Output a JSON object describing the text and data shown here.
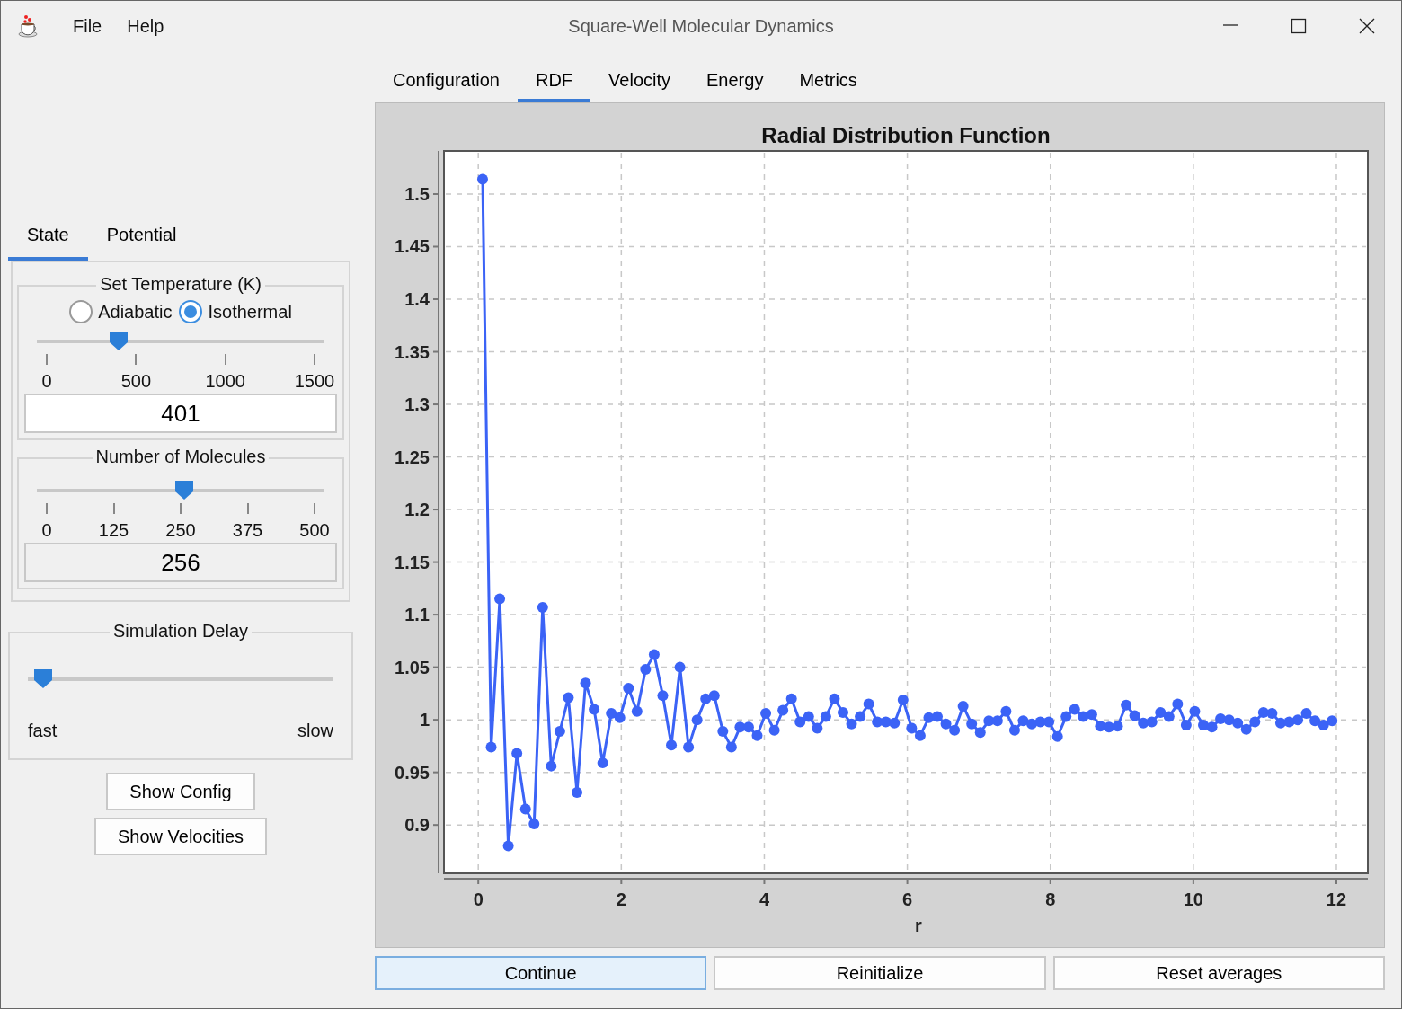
{
  "window": {
    "title": "Square-Well Molecular Dynamics"
  },
  "menu": [
    {
      "label": "File"
    },
    {
      "label": "Help"
    }
  ],
  "main_tabs": [
    {
      "label": "Configuration",
      "selected": false
    },
    {
      "label": "RDF",
      "selected": true
    },
    {
      "label": "Velocity",
      "selected": false
    },
    {
      "label": "Energy",
      "selected": false
    },
    {
      "label": "Metrics",
      "selected": false
    }
  ],
  "side_tabs": [
    {
      "label": "State",
      "selected": true
    },
    {
      "label": "Potential",
      "selected": false
    }
  ],
  "temperature": {
    "title": "Set Temperature (K)",
    "modes": [
      {
        "label": "Adiabatic",
        "selected": false
      },
      {
        "label": "Isothermal",
        "selected": true
      }
    ],
    "slider": {
      "level": 0.267,
      "ticks": [
        "0",
        "500",
        "1000",
        "1500"
      ]
    },
    "value": "401"
  },
  "molecules": {
    "title": "Number of Molecules",
    "slider": {
      "level": 0.512,
      "ticks": [
        "0",
        "125",
        "250",
        "375",
        "500"
      ]
    },
    "value": "256"
  },
  "delay": {
    "title": "Simulation Delay",
    "slider": {
      "level": 0.02
    },
    "min_label": "fast",
    "max_label": "slow"
  },
  "side_buttons": [
    {
      "label": "Show Config"
    },
    {
      "label": "Show Velocities"
    }
  ],
  "chart": {
    "chart_data": {
      "type": "line",
      "title": "Radial Distribution Function",
      "xlabel": "r",
      "x": [
        0.06,
        0.18,
        0.3,
        0.42,
        0.54,
        0.66,
        0.78,
        0.9,
        1.02,
        1.14,
        1.26,
        1.38,
        1.5,
        1.62,
        1.74,
        1.86,
        1.98,
        2.1,
        2.22,
        2.34,
        2.46,
        2.58,
        2.7,
        2.82,
        2.94,
        3.06,
        3.18,
        3.3,
        3.42,
        3.54,
        3.66,
        3.78,
        3.9,
        4.02,
        4.14,
        4.26,
        4.38,
        4.5,
        4.62,
        4.74,
        4.86,
        4.98,
        5.1,
        5.22,
        5.34,
        5.46,
        5.58,
        5.7,
        5.82,
        5.94,
        6.06,
        6.18,
        6.3,
        6.42,
        6.54,
        6.66,
        6.78,
        6.9,
        7.02,
        7.14,
        7.26,
        7.38,
        7.5,
        7.62,
        7.74,
        7.86,
        7.98,
        8.1,
        8.22,
        8.34,
        8.46,
        8.58,
        8.7,
        8.82,
        8.94,
        9.06,
        9.18,
        9.3,
        9.42,
        9.54,
        9.66,
        9.78,
        9.9,
        10.02,
        10.14,
        10.26,
        10.38,
        10.5,
        10.62,
        10.74,
        10.86,
        10.98,
        11.1,
        11.22,
        11.34,
        11.46,
        11.58,
        11.7,
        11.82,
        11.94
      ],
      "grid": true,
      "series": [
        {
          "color": "#3b63f6",
          "marker": "circle",
          "values": [
            1.514,
            0.974,
            1.115,
            0.88,
            0.968,
            0.915,
            0.901,
            1.107,
            0.956,
            0.989,
            1.021,
            0.931,
            1.035,
            1.01,
            0.959,
            1.006,
            1.002,
            1.03,
            1.008,
            1.048,
            1.062,
            1.023,
            0.976,
            1.05,
            0.974,
            1.0,
            1.02,
            1.023,
            0.989,
            0.974,
            0.993,
            0.993,
            0.985,
            1.006,
            0.99,
            1.009,
            1.02,
            0.998,
            1.003,
            0.992,
            1.003,
            1.02,
            1.007,
            0.996,
            1.003,
            1.015,
            0.998,
            0.998,
            0.997,
            1.019,
            0.992,
            0.985,
            1.002,
            1.003,
            0.996,
            0.99,
            1.013,
            0.996,
            0.988,
            0.999,
            0.999,
            1.008,
            0.99,
            0.999,
            0.996,
            0.998,
            0.998,
            0.984,
            1.003,
            1.01,
            1.003,
            1.005,
            0.994,
            0.993,
            0.994,
            1.014,
            1.004,
            0.997,
            0.998,
            1.007,
            1.003,
            1.015,
            0.995,
            1.008,
            0.995,
            0.993,
            1.001,
            1.0,
            0.997,
            0.991,
            0.998,
            1.007,
            1.006,
            0.997,
            0.998,
            1.0,
            1.006,
            0.999,
            0.995,
            0.999
          ]
        }
      ],
      "xlim": [
        -0.48,
        12.44
      ],
      "ylim": [
        0.854,
        1.541
      ],
      "xticks": [
        0,
        2,
        4,
        6,
        8,
        10,
        12
      ],
      "yticks": [
        0.9,
        0.95,
        1,
        1.05,
        1.1,
        1.15,
        1.2,
        1.25,
        1.3,
        1.35,
        1.4,
        1.45,
        1.5
      ]
    }
  },
  "buttons": [
    {
      "label": "Continue",
      "default": true
    },
    {
      "label": "Reinitialize",
      "default": false
    },
    {
      "label": "Reset averages",
      "default": false
    }
  ]
}
